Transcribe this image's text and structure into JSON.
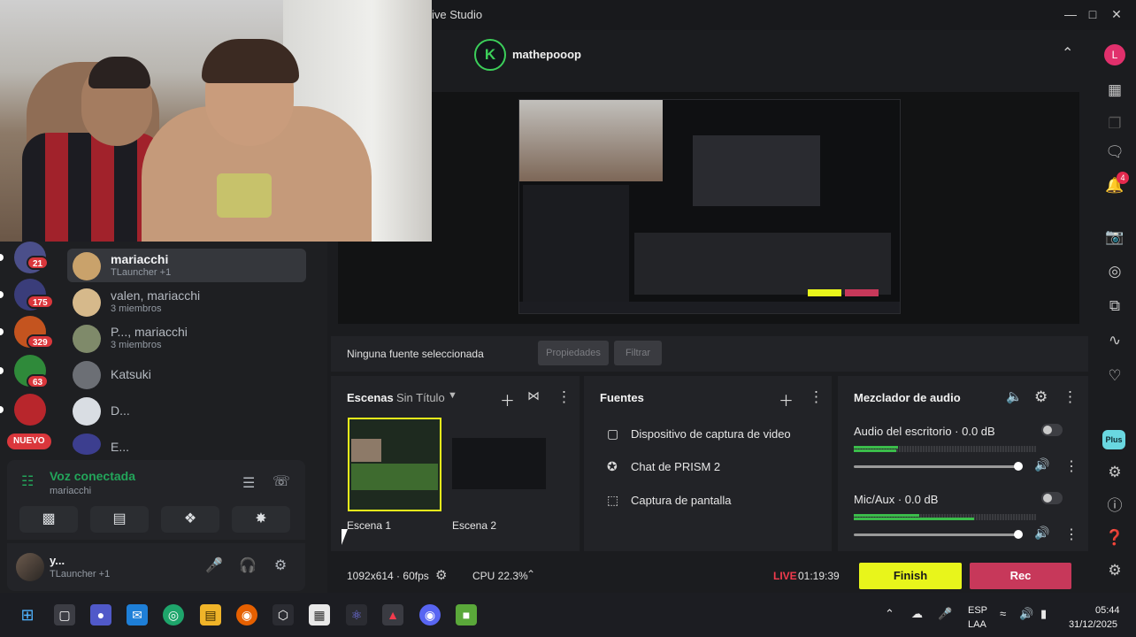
{
  "prism": {
    "app_title": "ive Studio",
    "channel": {
      "name": "mathepooop",
      "logo_letter": "K"
    },
    "user_initial": "L",
    "notification_count": "4",
    "plus_label": "Plus",
    "source_bar": {
      "no_source": "Ninguna fuente seleccionada",
      "properties": "Propiedades",
      "filter": "Filtrar"
    },
    "scenes": {
      "title": "Escenas",
      "collection": "Sin Título",
      "items": [
        "Escena 1",
        "Escena 2"
      ]
    },
    "sources": {
      "title": "Fuentes",
      "items": [
        "Dispositivo de captura de video",
        "Chat de PRISM 2",
        "Captura de pantalla"
      ]
    },
    "mixer": {
      "title": "Mezclador de audio",
      "channels": [
        {
          "name": "Audio del escritorio",
          "db": "0.0 dB",
          "volume": 0.98
        },
        {
          "name": "Mic/Aux",
          "db": "0.0 dB",
          "volume": 0.98
        }
      ]
    },
    "status": {
      "resolution": "1092x614",
      "fps": "60fps",
      "cpu": "CPU 22.3%",
      "live": "LIVE",
      "elapsed": "01:19:39",
      "finish": "Finish",
      "rec": "Rec"
    }
  },
  "discord": {
    "servers": [
      {
        "badge": "21"
      },
      {
        "badge": "175"
      },
      {
        "badge": "329"
      },
      {
        "badge": "63"
      },
      {
        "badge": ""
      }
    ],
    "new_label": "NUEVO",
    "dms": [
      {
        "name": "mariacchi",
        "sub": "TLauncher +1"
      },
      {
        "name": "valen, mariacchi",
        "sub": "3 miembros"
      },
      {
        "name": "P..., mariacchi",
        "sub": "3 miembros"
      },
      {
        "name": "Katsuki",
        "sub": ""
      },
      {
        "name": "D...",
        "sub": ""
      },
      {
        "name": "E...",
        "sub": ""
      }
    ],
    "voice": {
      "title": "Voz conectada",
      "channel": "mariacchi"
    },
    "user": {
      "name": "y...",
      "activity": "TLauncher +1"
    }
  },
  "taskbar": {
    "lang1": "ESP",
    "lang2": "LAA",
    "time": "05:44",
    "date": "31/12/2025"
  },
  "colors": {
    "accent_live": "#f23b4d",
    "finish": "#e8f51b",
    "rec": "#c7385a",
    "discord_green": "#23a55a"
  }
}
